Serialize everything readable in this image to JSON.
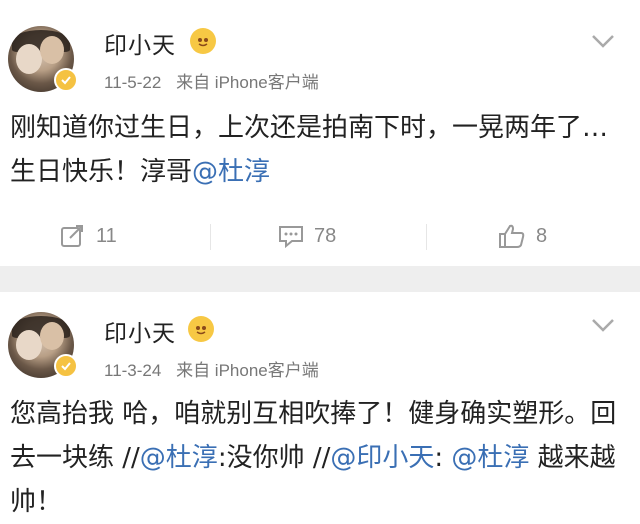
{
  "posts": [
    {
      "username": "印小天",
      "date": "11-5-22",
      "source": "来自 iPhone客户端",
      "content": {
        "text": "刚知道你过生日，上次还是拍南下时，一晃两年了…生日快乐！淳哥",
        "mention": "@杜淳"
      },
      "actions": {
        "repost": "11",
        "comment": "78",
        "like": "8"
      }
    },
    {
      "username": "印小天",
      "date": "11-3-24",
      "source": "来自 iPhone客户端",
      "content": {
        "text1": "您高抬我  哈，咱就别互相吹捧了！健身确实塑形。回去一块练  //",
        "mention1": "@杜淳",
        "text2": ":没你帅  //",
        "mention2": "@印小天",
        "text3": ": ",
        "mention3": "@杜淳",
        "text4": "  越来越帅！"
      }
    }
  ],
  "colors": {
    "link": "#3a6fb4",
    "separator": "#eeeeee",
    "badge": "#f7c844"
  },
  "icons": [
    "verified-icon",
    "vip-emoji-icon",
    "chevron-down-icon",
    "repost-icon",
    "comment-icon",
    "like-icon"
  ]
}
